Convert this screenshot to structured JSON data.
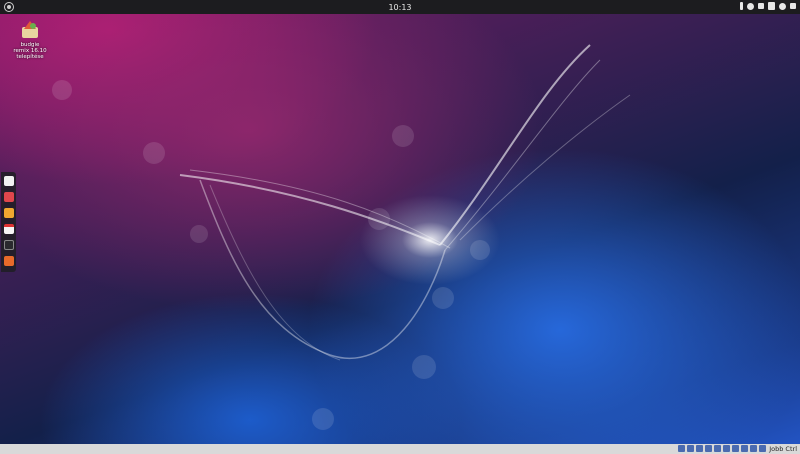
{
  "topbar": {
    "clock": "10:13"
  },
  "desktop_icon": {
    "line1": "budgie",
    "line2": "remix 16.10",
    "line3": "telepítése"
  },
  "dock": {
    "apps": [
      "music-icon",
      "photos-icon",
      "mail-icon",
      "calendar-icon",
      "video-icon",
      "software-icon"
    ]
  },
  "statusbar": {
    "host_key": "Jobb Ctrl"
  }
}
